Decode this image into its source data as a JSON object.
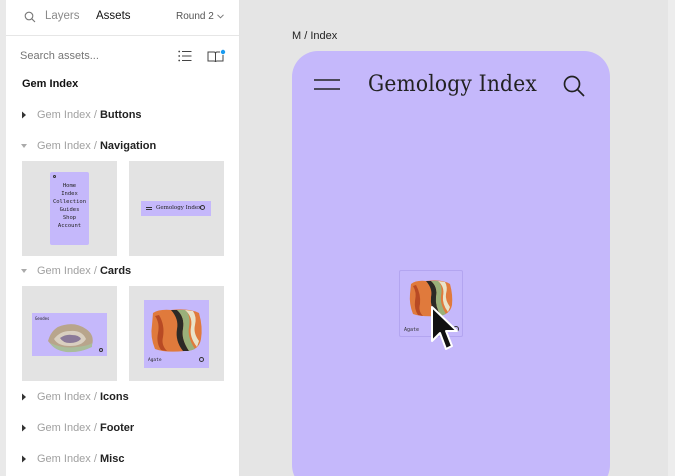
{
  "topbar": {
    "tab_layers": "Layers",
    "tab_assets": "Assets",
    "round_label": "Round 2"
  },
  "search": {
    "placeholder": "Search assets..."
  },
  "library": {
    "title": "Gem Index",
    "prefix": "Gem Index / ",
    "groups": [
      {
        "name": "Buttons",
        "expanded": false
      },
      {
        "name": "Navigation",
        "expanded": true
      },
      {
        "name": "Cards",
        "expanded": true
      },
      {
        "name": "Icons",
        "expanded": false
      },
      {
        "name": "Footer",
        "expanded": false
      },
      {
        "name": "Misc",
        "expanded": false
      }
    ]
  },
  "navigation_thumbs": {
    "menu_items": [
      "Home",
      "Index",
      "Collection",
      "Guides",
      "Shop",
      "Account"
    ],
    "header_title": "Gemology Index"
  },
  "cards_thumbs": {
    "card1_caption": "Geodes",
    "card2_caption": "Agate"
  },
  "canvas": {
    "frame_label": "M / Index",
    "phone_title": "Gemology Index",
    "drag_card_caption": "Agate"
  },
  "colors": {
    "accent_purple": "#c5b8fb",
    "panel_bg": "#ffffff",
    "canvas_bg": "#e5e5e5",
    "notification_dot": "#1a9bf0"
  }
}
